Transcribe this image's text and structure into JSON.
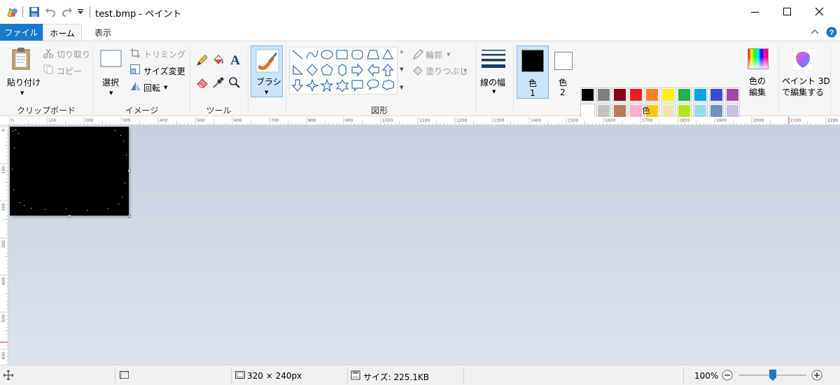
{
  "window": {
    "title": "test.bmp - ペイント"
  },
  "tabs": {
    "file": "ファイル",
    "home": "ホーム",
    "view": "表示"
  },
  "clipboard": {
    "paste": "貼り付け",
    "cut": "切り取り",
    "copy": "コピー",
    "label": "クリップボード"
  },
  "image_group": {
    "select": "選択",
    "crop": "トリミング",
    "resize": "サイズ変更",
    "rotate": "回転",
    "label": "イメージ"
  },
  "tools": {
    "label": "ツール"
  },
  "brushes": {
    "label": "ブラシ"
  },
  "shapes": {
    "outline": "輪郭",
    "fill": "塗りつぶし",
    "label": "図形"
  },
  "size": {
    "label": "線の幅"
  },
  "colors": {
    "color1": "色",
    "color1_num": "1",
    "color2": "色",
    "color2_num": "2",
    "edit_line1": "色の",
    "edit_line2": "編集",
    "label": "色",
    "color1_value": "#000000",
    "color2_value": "#ffffff",
    "palette_row1": [
      "#000000",
      "#7f7f7f",
      "#880015",
      "#ed1c24",
      "#ff7f27",
      "#fff200",
      "#22b14c",
      "#00a2e8",
      "#3f48cc",
      "#a349a4"
    ],
    "palette_row2": [
      "#ffffff",
      "#c3c3c3",
      "#b97a57",
      "#ffaec9",
      "#ffc90e",
      "#efe4b0",
      "#b5e61d",
      "#99d9ea",
      "#7092be",
      "#c8bfe7"
    ]
  },
  "paint3d": {
    "line1": "ペイント 3D",
    "line2": "で編集する"
  },
  "ruler": {
    "h_ticks": [
      "0",
      "100",
      "200",
      "300",
      "400",
      "500",
      "600",
      "700",
      "800",
      "900",
      "1000",
      "1100",
      "1200",
      "1300",
      "1400",
      "1500",
      "1600",
      "1700",
      "1800",
      "1900",
      "2000",
      "2100",
      "2200"
    ],
    "v_ticks": [
      "0",
      "100",
      "200",
      "300",
      "400",
      "500",
      "600"
    ]
  },
  "status": {
    "dimensions": "320 × 240px",
    "size": "サイズ: 225.1KB",
    "zoom": "100%",
    "zoom_level": 0.5
  }
}
